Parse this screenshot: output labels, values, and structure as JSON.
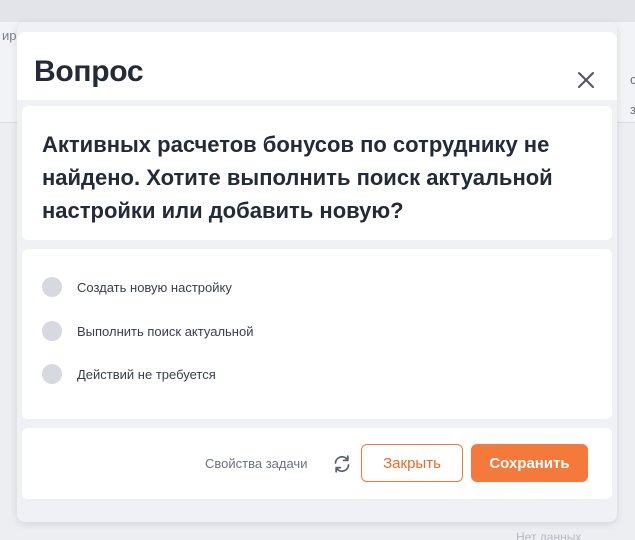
{
  "background": {
    "left_fragment": "ир",
    "right_fragment_1": "с",
    "right_fragment_2": "з",
    "bottom_fragment": "Нет данных"
  },
  "dialog": {
    "title": "Вопрос",
    "question": "Активных расчетов бонусов по сотруднику не найдено. Хотите выполнить поиск актуальной настройки или добавить новую?",
    "options": [
      {
        "label": "Создать новую настройку",
        "selected": false
      },
      {
        "label": "Выполнить поиск актуальной",
        "selected": false
      },
      {
        "label": "Действий не требуется",
        "selected": false
      }
    ],
    "footer": {
      "task_properties_label": "Свойства задачи",
      "close_label": "Закрыть",
      "save_label": "Сохранить"
    }
  },
  "colors": {
    "accent": "#f5793a",
    "title_text": "#232a38",
    "radio_unselected": "#d6d9df"
  },
  "icons": {
    "close": "close-icon",
    "refresh": "refresh-icon"
  }
}
